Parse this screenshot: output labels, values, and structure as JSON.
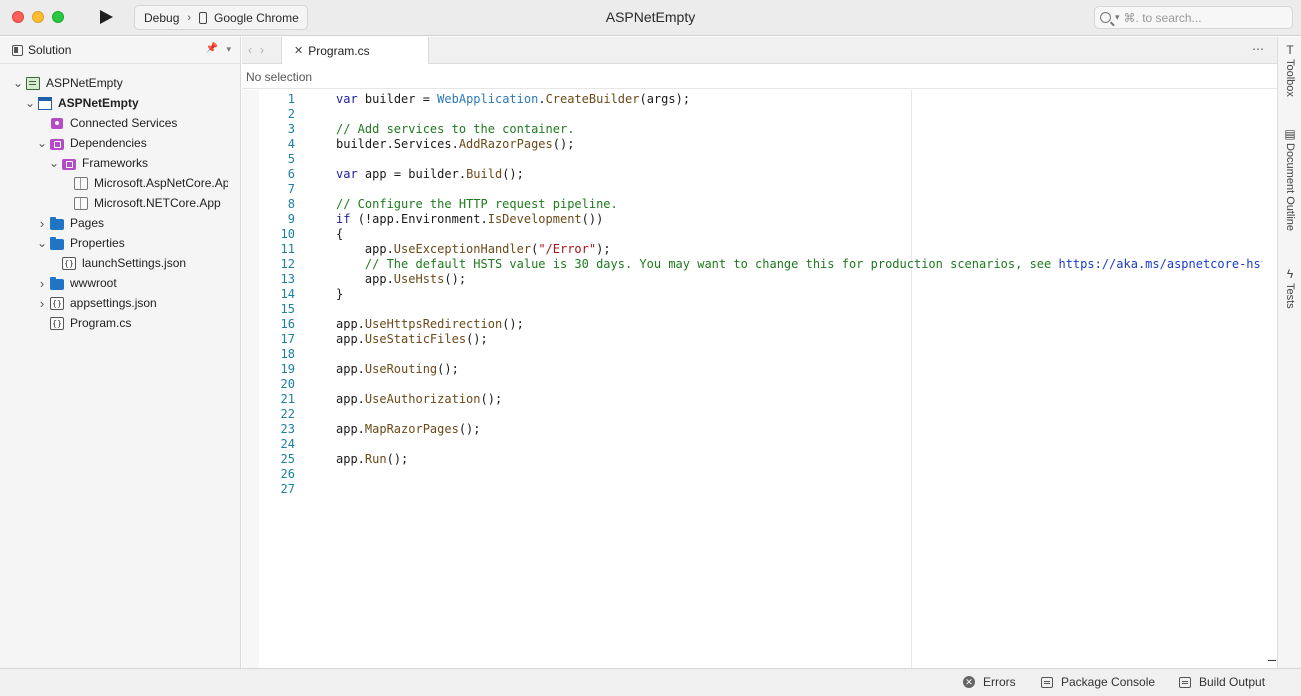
{
  "window": {
    "title": "ASPNetEmpty"
  },
  "toolbar": {
    "config": "Debug",
    "target": "Google Chrome",
    "search_placeholder": "⌘. to search..."
  },
  "solution_pad": {
    "title": "Solution",
    "items": [
      {
        "label": "ASPNetEmpty",
        "icon": "solution-icon",
        "depth": 0,
        "chevron": "down",
        "bold": false
      },
      {
        "label": "ASPNetEmpty",
        "icon": "project-icon",
        "depth": 1,
        "chevron": "down",
        "bold": true
      },
      {
        "label": "Connected Services",
        "icon": "connected-services-icon",
        "depth": 2,
        "chevron": "",
        "bold": false
      },
      {
        "label": "Dependencies",
        "icon": "dependencies-folder-icon",
        "depth": 2,
        "chevron": "down",
        "bold": false
      },
      {
        "label": "Frameworks",
        "icon": "frameworks-folder-icon",
        "depth": 3,
        "chevron": "down",
        "bold": false
      },
      {
        "label": "Microsoft.AspNetCore.App",
        "icon": "package-icon",
        "depth": 4,
        "chevron": "",
        "bold": false
      },
      {
        "label": "Microsoft.NETCore.App",
        "icon": "package-icon",
        "depth": 4,
        "chevron": "",
        "bold": false
      },
      {
        "label": "Pages",
        "icon": "folder-icon",
        "depth": 2,
        "chevron": "right",
        "bold": false
      },
      {
        "label": "Properties",
        "icon": "folder-icon",
        "depth": 2,
        "chevron": "down",
        "bold": false
      },
      {
        "label": "launchSettings.json",
        "icon": "json-file-icon",
        "depth": 3,
        "chevron": "",
        "bold": false
      },
      {
        "label": "wwwroot",
        "icon": "folder-icon",
        "depth": 2,
        "chevron": "right",
        "bold": false
      },
      {
        "label": "appsettings.json",
        "icon": "json-file-icon",
        "depth": 2,
        "chevron": "right",
        "bold": false
      },
      {
        "label": "Program.cs",
        "icon": "cs-file-icon",
        "depth": 2,
        "chevron": "",
        "bold": false
      }
    ]
  },
  "editor": {
    "tab_label": "Program.cs",
    "breadcrumb": "No selection",
    "lines": [
      [
        [
          "kw",
          "var"
        ],
        [
          "",
          "builder = "
        ],
        [
          "ty",
          "WebApplication"
        ],
        [
          "",
          "."
        ],
        [
          "mt",
          "CreateBuilder"
        ],
        [
          "",
          "(args);"
        ]
      ],
      [],
      [
        [
          "cm",
          "// Add services to the container."
        ]
      ],
      [
        [
          "",
          "builder.Services."
        ],
        [
          "mt",
          "AddRazorPages"
        ],
        [
          "",
          "();"
        ]
      ],
      [],
      [
        [
          "kw",
          "var"
        ],
        [
          "",
          "app = builder."
        ],
        [
          "mt",
          "Build"
        ],
        [
          "",
          "();"
        ]
      ],
      [],
      [
        [
          "cm",
          "// Configure the HTTP request pipeline."
        ]
      ],
      [
        [
          "kw",
          "if"
        ],
        [
          "",
          "(!app.Environment."
        ],
        [
          "mt",
          "IsDevelopment"
        ],
        [
          "",
          "())"
        ]
      ],
      [
        [
          "",
          "{"
        ]
      ],
      [
        [
          "",
          "    app."
        ],
        [
          "mt",
          "UseExceptionHandler"
        ],
        [
          "",
          "("
        ],
        [
          "st",
          "\"/Error\""
        ],
        [
          "",
          ");"
        ]
      ],
      [
        [
          "cm",
          "    // The default HSTS value is 30 days. You may want to change this for production scenarios, see "
        ],
        [
          "ur",
          "https://aka.ms/aspnetcore-hsts"
        ]
      ],
      [
        [
          "",
          "    app."
        ],
        [
          "mt",
          "UseHsts"
        ],
        [
          "",
          "();"
        ]
      ],
      [
        [
          "",
          "}"
        ]
      ],
      [],
      [
        [
          "",
          "app."
        ],
        [
          "mt",
          "UseHttpsRedirection"
        ],
        [
          "",
          "();"
        ]
      ],
      [
        [
          "",
          "app."
        ],
        [
          "mt",
          "UseStaticFiles"
        ],
        [
          "",
          "();"
        ]
      ],
      [],
      [
        [
          "",
          "app."
        ],
        [
          "mt",
          "UseRouting"
        ],
        [
          "",
          "();"
        ]
      ],
      [],
      [
        [
          "",
          "app."
        ],
        [
          "mt",
          "UseAuthorization"
        ],
        [
          "",
          "();"
        ]
      ],
      [],
      [
        [
          "",
          "app."
        ],
        [
          "mt",
          "MapRazorPages"
        ],
        [
          "",
          "();"
        ]
      ],
      [],
      [
        [
          "",
          "app."
        ],
        [
          "mt",
          "Run"
        ],
        [
          "",
          "();"
        ]
      ],
      [],
      []
    ]
  },
  "right_dock": [
    {
      "label": "Toolbox",
      "icon": "toolbox-icon"
    },
    {
      "label": "Document Outline",
      "icon": "document-outline-icon"
    },
    {
      "label": "Tests",
      "icon": "tests-icon"
    }
  ],
  "status_bar": {
    "errors": "Errors",
    "package_console": "Package Console",
    "build_output": "Build Output"
  }
}
